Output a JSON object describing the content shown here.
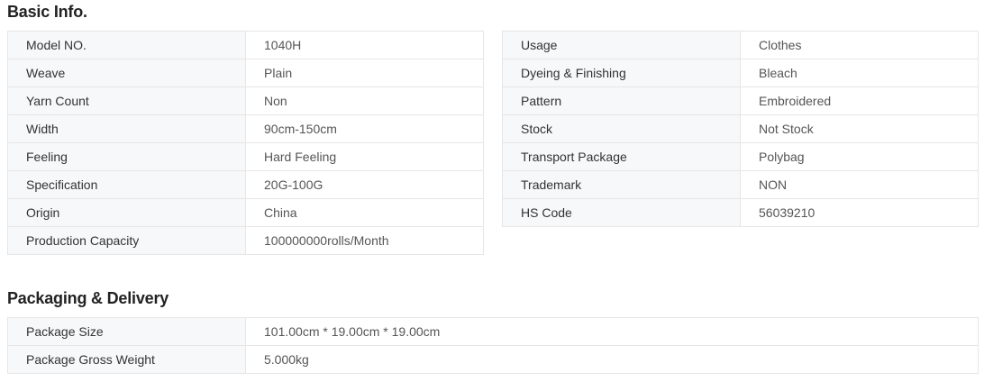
{
  "basic_info": {
    "title": "Basic Info.",
    "left": [
      {
        "label": "Model NO.",
        "value": "1040H"
      },
      {
        "label": "Weave",
        "value": "Plain"
      },
      {
        "label": "Yarn Count",
        "value": "Non"
      },
      {
        "label": "Width",
        "value": "90cm-150cm"
      },
      {
        "label": "Feeling",
        "value": "Hard Feeling"
      },
      {
        "label": "Specification",
        "value": "20G-100G"
      },
      {
        "label": "Origin",
        "value": "China"
      },
      {
        "label": "Production Capacity",
        "value": "100000000rolls/Month"
      }
    ],
    "right": [
      {
        "label": "Usage",
        "value": "Clothes"
      },
      {
        "label": "Dyeing & Finishing",
        "value": "Bleach"
      },
      {
        "label": "Pattern",
        "value": "Embroidered"
      },
      {
        "label": "Stock",
        "value": "Not Stock"
      },
      {
        "label": "Transport Package",
        "value": "Polybag"
      },
      {
        "label": "Trademark",
        "value": "NON"
      },
      {
        "label": "HS Code",
        "value": "56039210"
      }
    ]
  },
  "packaging": {
    "title": "Packaging & Delivery",
    "rows": [
      {
        "label": "Package Size",
        "value": "101.00cm * 19.00cm * 19.00cm"
      },
      {
        "label": "Package Gross Weight",
        "value": "5.000kg"
      }
    ]
  }
}
